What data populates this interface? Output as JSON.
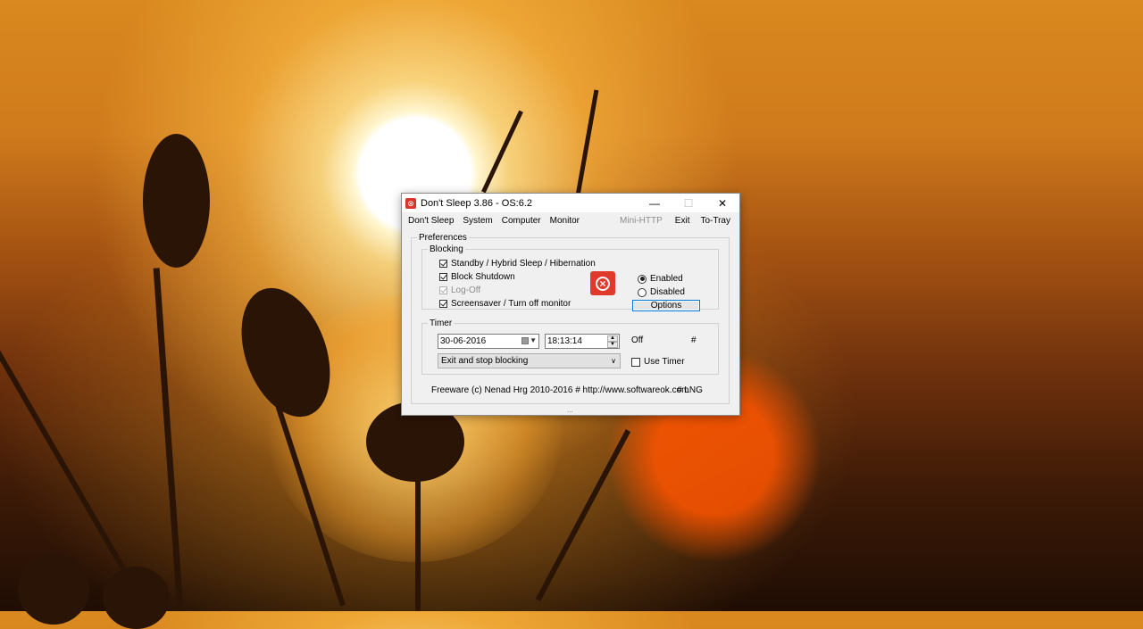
{
  "window": {
    "title": "Don't Sleep 3.86 - OS:6.2",
    "minimize_glyph": "—",
    "maximize_glyph": "☐",
    "close_glyph": "✕"
  },
  "menu": {
    "left": [
      "Don't Sleep",
      "System",
      "Computer",
      "Monitor"
    ],
    "right": [
      "Mini-HTTP",
      "Exit",
      "To-Tray"
    ]
  },
  "preferences": {
    "legend": "Preferences",
    "blocking": {
      "legend": "Blocking",
      "checkboxes": [
        {
          "label": "Standby / Hybrid Sleep / Hibernation",
          "checked": true,
          "enabled": true
        },
        {
          "label": "Block Shutdown",
          "checked": true,
          "enabled": true
        },
        {
          "label": "Log-Off",
          "checked": true,
          "enabled": false
        },
        {
          "label": "Screensaver / Turn off monitor",
          "checked": true,
          "enabled": true
        }
      ],
      "status_icon": "stop-circle-icon",
      "radio_enabled": "Enabled",
      "radio_disabled": "Disabled",
      "selected": "Enabled",
      "options_button": "Options"
    },
    "timer": {
      "legend": "Timer",
      "date": "30-06-2016",
      "time": "18:13:14",
      "status": "Off",
      "hash": "#",
      "action": "Exit and stop blocking",
      "use_timer_label": "Use Timer",
      "use_timer_checked": false
    },
    "footer": {
      "copyright": "Freeware (c) Nenad Hrg 2010-2016 # http://www.softwareok.com",
      "lng": "# LNG"
    }
  },
  "grip": "...",
  "colors": {
    "accent": "#0078d7",
    "icon_red": "#e03a2c"
  }
}
